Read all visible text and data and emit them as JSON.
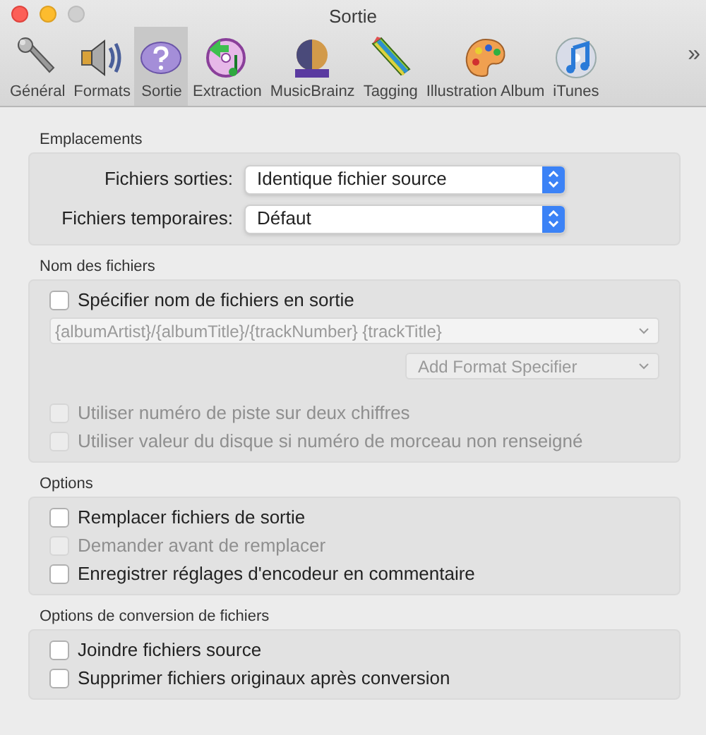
{
  "window": {
    "title": "Sortie"
  },
  "tabs": [
    {
      "label": "Général",
      "selected": false
    },
    {
      "label": "Formats",
      "selected": false
    },
    {
      "label": "Sortie",
      "selected": true
    },
    {
      "label": "Extraction",
      "selected": false
    },
    {
      "label": "MusicBrainz",
      "selected": false
    },
    {
      "label": "Tagging",
      "selected": false
    },
    {
      "label": "Illustration Album",
      "selected": false
    },
    {
      "label": "iTunes",
      "selected": false
    }
  ],
  "overflow": "»",
  "sections": [
    {
      "title": "Emplacements",
      "items": [
        {
          "kind": "popup",
          "label": "Fichiers sorties:",
          "value": "Identique fichier source"
        },
        {
          "kind": "popup",
          "label": "Fichiers temporaires:",
          "value": "Défaut"
        }
      ]
    },
    {
      "title": "Nom des fichiers",
      "items": [
        {
          "kind": "checkbox",
          "label": "Spécifier nom de fichiers en sortie",
          "checked": false,
          "disabled": false
        },
        {
          "kind": "combo",
          "value": "{albumArtist}/{albumTitle}/{trackNumber} {trackTitle}",
          "disabled": true
        },
        {
          "kind": "menu",
          "label": "Add Format Specifier",
          "disabled": true
        },
        {
          "kind": "checkbox",
          "label": "Utiliser numéro de piste sur deux chiffres",
          "checked": false,
          "disabled": true
        },
        {
          "kind": "checkbox",
          "label": "Utiliser valeur du disque si numéro de morceau non renseigné",
          "checked": false,
          "disabled": true
        }
      ]
    },
    {
      "title": "Options",
      "items": [
        {
          "kind": "checkbox",
          "label": "Remplacer fichiers de sortie",
          "checked": false,
          "disabled": false
        },
        {
          "kind": "checkbox",
          "label": "Demander avant de remplacer",
          "checked": false,
          "disabled": true
        },
        {
          "kind": "checkbox",
          "label": "Enregistrer réglages d'encodeur en commentaire",
          "checked": false,
          "disabled": false
        }
      ]
    },
    {
      "title": "Options de conversion de fichiers",
      "items": [
        {
          "kind": "checkbox",
          "label": "Joindre fichiers source",
          "checked": false,
          "disabled": false
        },
        {
          "kind": "checkbox",
          "label": "Supprimer fichiers originaux après conversion",
          "checked": false,
          "disabled": false
        }
      ]
    }
  ]
}
